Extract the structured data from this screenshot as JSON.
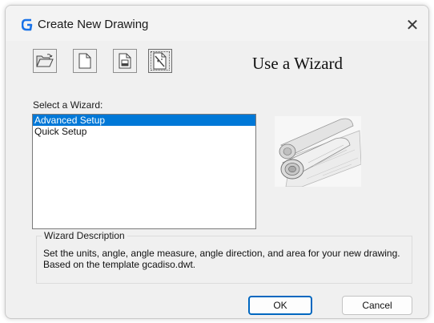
{
  "window": {
    "title": "Create New Drawing",
    "close_glyph": "✕"
  },
  "toolbar": {
    "buttons": [
      {
        "name": "open-drawing",
        "icon": "folder-open-icon"
      },
      {
        "name": "start-from-scratch",
        "icon": "blank-page-icon"
      },
      {
        "name": "use-template",
        "icon": "template-page-icon"
      },
      {
        "name": "use-wizard",
        "icon": "wizard-page-icon",
        "active": true
      }
    ]
  },
  "heading": "Use a Wizard",
  "wizard_list": {
    "label": "Select a Wizard:",
    "items": [
      "Advanced Setup",
      "Quick Setup"
    ],
    "selected": "Advanced Setup"
  },
  "preview": {
    "icon": "rolled-blueprints-image"
  },
  "description": {
    "legend": "Wizard Description",
    "text": "Set the units, angle, angle measure, angle direction, and area for your new drawing. Based on the template gcadiso.dwt."
  },
  "buttons": {
    "ok": "OK",
    "cancel": "Cancel"
  },
  "colors": {
    "accent": "#0078d7",
    "logo": "#1a73e8"
  }
}
